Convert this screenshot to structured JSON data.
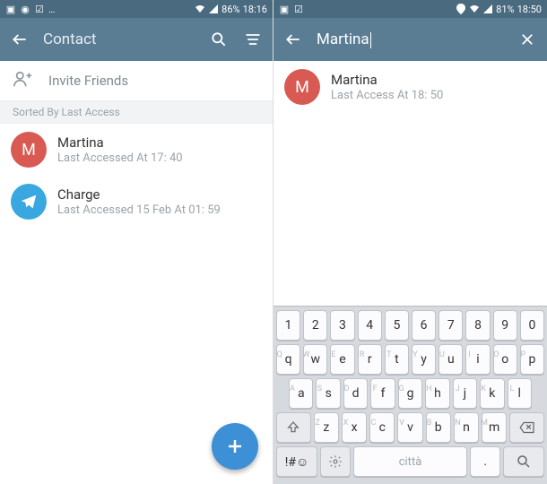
{
  "colors": {
    "appbar": "#5a7d94",
    "fab": "#3d8fd6",
    "avatar_m": "#d85a52",
    "avatar_tg": "#3aa7e0"
  },
  "left": {
    "status": {
      "battery": "86%",
      "time": "18:16"
    },
    "title": "Contact",
    "invite_label": "Invite Friends",
    "section_label": "Sorted By Last Access",
    "contacts": [
      {
        "initial": "M",
        "name": "Martina",
        "sub": "Last Accessed At 17: 40"
      },
      {
        "initial": "",
        "name": "Charge",
        "sub": "Last Accessed 15 Feb At 01: 59"
      }
    ]
  },
  "right": {
    "status": {
      "battery": "81%",
      "time": "18:50"
    },
    "search_value": "Martina",
    "result": {
      "initial": "M",
      "name": "Martina",
      "sub": "Last Access At 18: 50"
    },
    "keyboard": {
      "row1": [
        "1",
        "2",
        "3",
        "4",
        "5",
        "6",
        "7",
        "8",
        "9",
        "0"
      ],
      "row2": [
        "q",
        "w",
        "e",
        "r",
        "t",
        "y",
        "u",
        "i",
        "o",
        "p"
      ],
      "row2_caps": [
        "Q",
        "W",
        "E",
        "R",
        "T",
        "Y",
        "U",
        "I",
        "O",
        "P"
      ],
      "row3": [
        "a",
        "s",
        "d",
        "f",
        "g",
        "h",
        "j",
        "k",
        "l"
      ],
      "row3_caps": [
        "A",
        "S",
        "D",
        "F",
        "G",
        "H",
        "J",
        "K",
        "L"
      ],
      "row4": [
        "z",
        "x",
        "c",
        "v",
        "b",
        "n",
        "m"
      ],
      "row4_caps": [
        "Z",
        "X",
        "C",
        "V",
        "B",
        "N",
        "M"
      ],
      "sym_key": "!#☺",
      "space_hint": "città",
      "dot_key": "."
    }
  }
}
